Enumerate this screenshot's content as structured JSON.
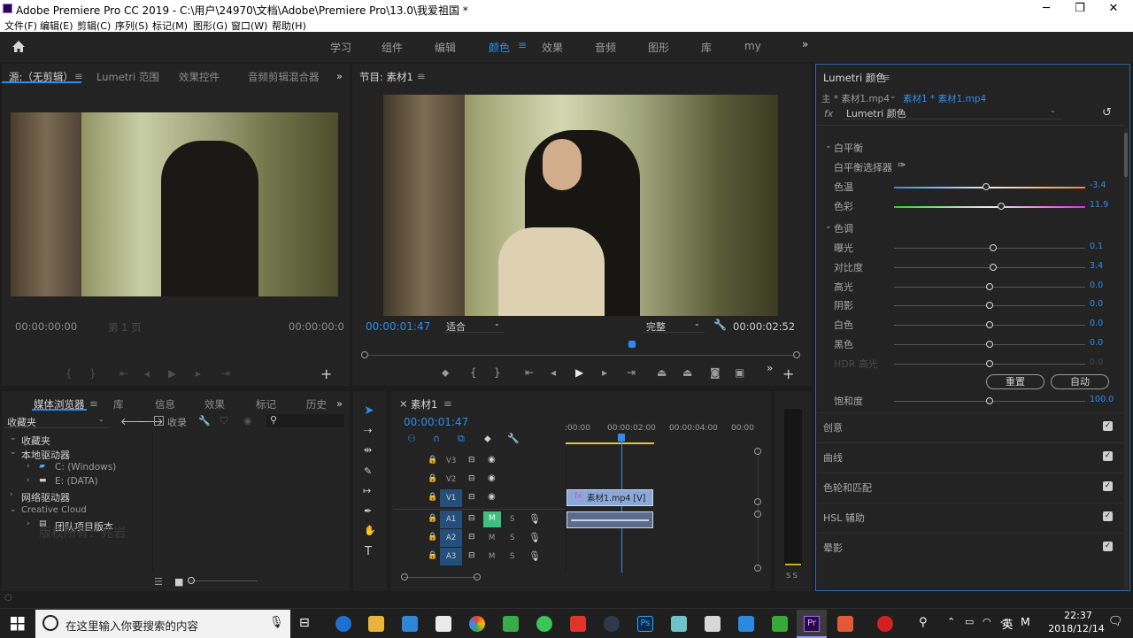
{
  "window": {
    "title": "Adobe Premiere Pro CC 2019 - C:\\用户\\24970\\文档\\Adobe\\Premiere Pro\\13.0\\我爱祖国 *",
    "minimize": "─",
    "maximize": "❐",
    "close": "✕"
  },
  "menu": [
    "文件(F)",
    "编辑(E)",
    "剪辑(C)",
    "序列(S)",
    "标记(M)",
    "图形(G)",
    "窗口(W)",
    "帮助(H)"
  ],
  "workspaces": [
    "学习",
    "组件",
    "编辑",
    "颜色",
    "效果",
    "音频",
    "图形",
    "库",
    "my"
  ],
  "workspace_active": "颜色",
  "source_panel": {
    "tabs": [
      "源:（无剪辑）",
      "Lumetri 范围",
      "效果控件",
      "音频剪辑混合器"
    ],
    "timecode_left": "00:00:00:00",
    "fit": "第 1 页",
    "timecode_right": "00:00:00:0"
  },
  "program_panel": {
    "tab": "节目: 素材1",
    "timecode": "00:00:01:47",
    "fit": "适合",
    "quality": "完整",
    "duration": "00:00:02:52"
  },
  "media_panel": {
    "tabs": [
      "媒体浏览器",
      "库",
      "信息",
      "效果",
      "标记",
      "历史"
    ],
    "location": "收藏夹",
    "ingest": "收录",
    "tree": [
      {
        "label": "收藏夹",
        "level": 0
      },
      {
        "label": "本地驱动器",
        "level": 0
      },
      {
        "label": "C: (Windows)",
        "level": 1
      },
      {
        "label": "E: (DATA)",
        "level": 1
      },
      {
        "label": "网络驱动器",
        "level": 0
      },
      {
        "label": "Creative Cloud",
        "level": 0
      },
      {
        "label": "团队项目版本",
        "level": 1
      }
    ],
    "watermark": "版权所有：兆岩"
  },
  "timeline": {
    "tab": "素材1",
    "timecode": "00:00:01:47",
    "ruler": [
      ":00:00",
      "00:00:02:00",
      "00:00:04:00",
      "00:00"
    ],
    "video_tracks": [
      "V3",
      "V2",
      "V1"
    ],
    "audio_tracks": [
      "A1",
      "A2",
      "A3"
    ],
    "clip_label": "素材1.mp4 [V]",
    "mute": "M",
    "solo": "S",
    "meter_labels": "S S"
  },
  "lumetri": {
    "title": "Lumetri 颜色",
    "master": "主 * 素材1.mp4",
    "clip": "素材1 * 素材1.mp4",
    "effect": "Lumetri 颜色",
    "white_balance": {
      "header": "白平衡",
      "picker": "白平衡选择器",
      "rows": [
        {
          "label": "色温",
          "value": "-3.4",
          "pos": 0.48
        },
        {
          "label": "色彩",
          "value": "11.9",
          "pos": 0.56
        }
      ]
    },
    "tone": {
      "header": "色调",
      "rows": [
        {
          "label": "曝光",
          "value": "0.1",
          "pos": 0.52
        },
        {
          "label": "对比度",
          "value": "3.4",
          "pos": 0.52
        },
        {
          "label": "高光",
          "value": "0.0",
          "pos": 0.5
        },
        {
          "label": "阴影",
          "value": "0.0",
          "pos": 0.5
        },
        {
          "label": "白色",
          "value": "0.0",
          "pos": 0.5
        },
        {
          "label": "黑色",
          "value": "0.0",
          "pos": 0.5
        },
        {
          "label": "HDR 高光",
          "value": "0.0",
          "pos": 0.5
        }
      ]
    },
    "reset": "重置",
    "auto": "自动",
    "saturation": {
      "label": "饱和度",
      "value": "100.0",
      "pos": 0.5
    },
    "sections": [
      "创意",
      "曲线",
      "色轮和匹配",
      "HSL 辅助",
      "晕影"
    ]
  },
  "taskbar": {
    "search": "在这里输入你要搜索的内容",
    "time": "22:37",
    "date": "2018/12/14",
    "lang": "英"
  },
  "colors": {
    "accent": "#2d8ceb",
    "panel": "#232323",
    "bg": "#1d1d1d"
  }
}
